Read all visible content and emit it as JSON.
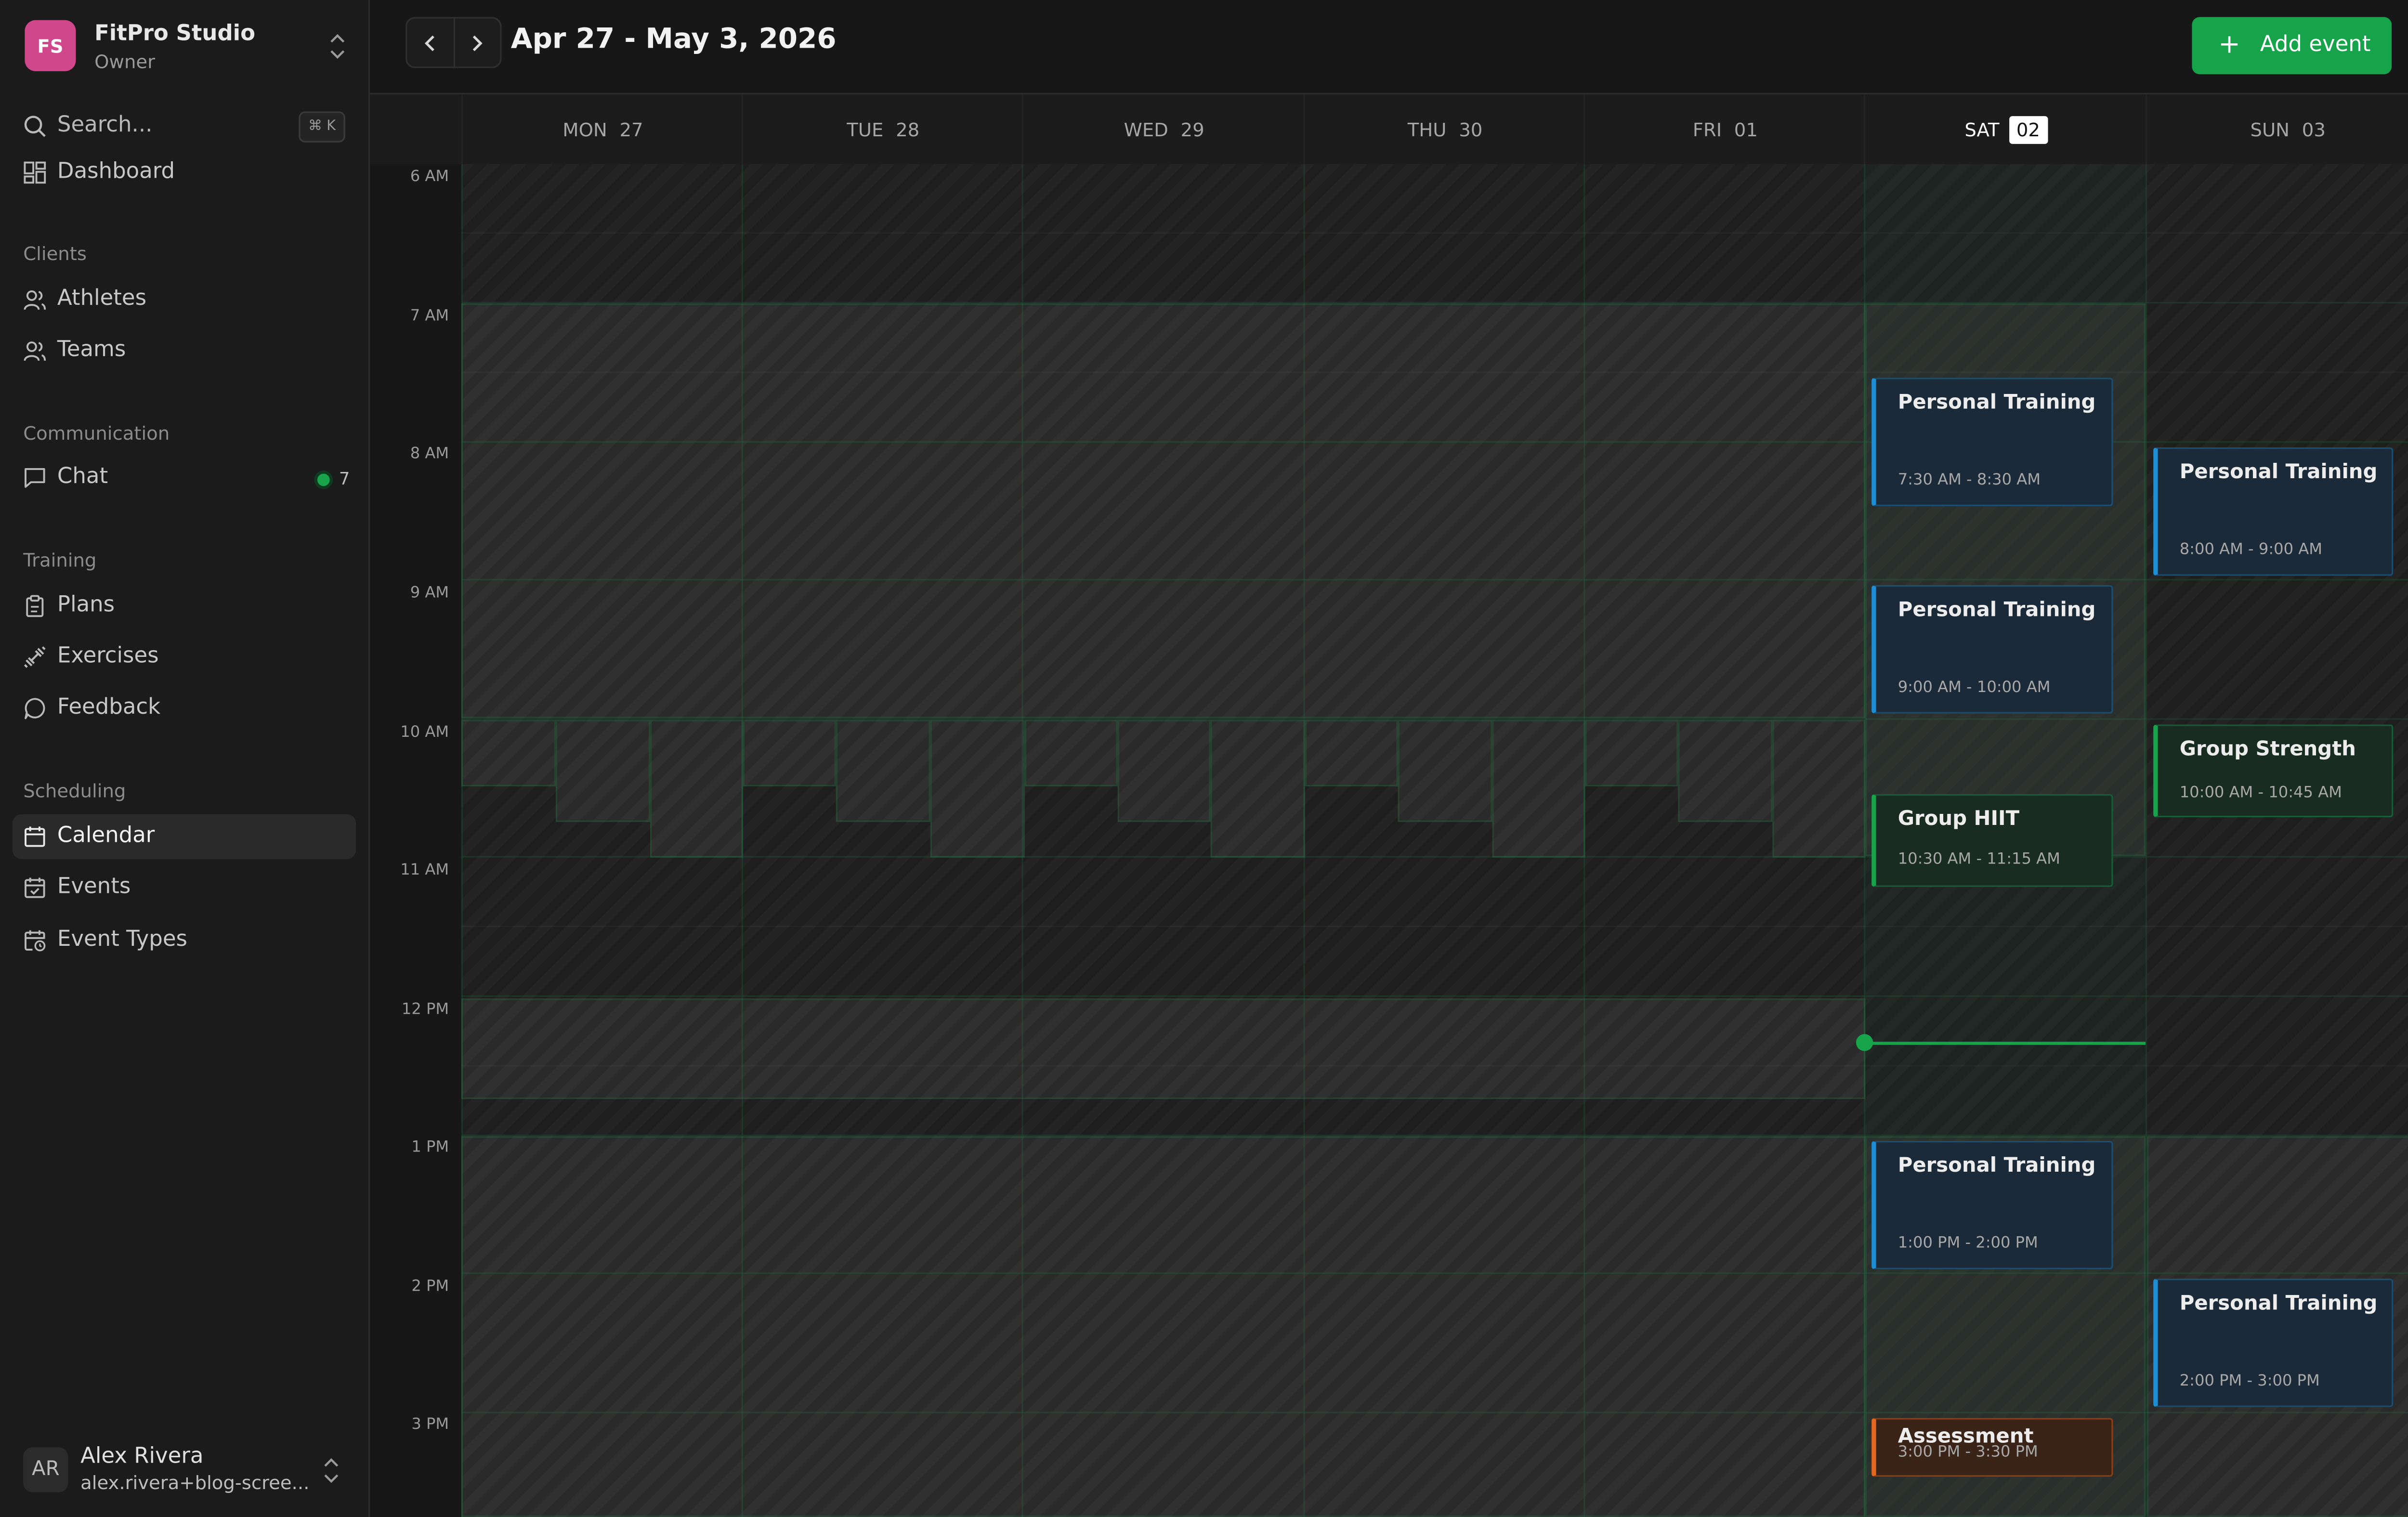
{
  "org": {
    "initials": "FS",
    "name": "FitPro Studio",
    "role": "Owner"
  },
  "search": {
    "label": "Search...",
    "shortcut": "⌘ K"
  },
  "nav": {
    "dashboard": "Dashboard",
    "sections": {
      "clients": "Clients",
      "communication": "Communication",
      "training": "Training",
      "scheduling": "Scheduling"
    },
    "athletes": "Athletes",
    "teams": "Teams",
    "chat": "Chat",
    "chat_badge": "7",
    "plans": "Plans",
    "exercises": "Exercises",
    "feedback": "Feedback",
    "calendar": "Calendar",
    "events": "Events",
    "event_types": "Event Types"
  },
  "user": {
    "initials": "AR",
    "name": "Alex Rivera",
    "email": "alex.rivera+blog-scree..."
  },
  "header": {
    "range": "Apr 27 - May 3, 2026",
    "add_event": "Add event"
  },
  "days": [
    {
      "dow": "MON",
      "num": "27"
    },
    {
      "dow": "TUE",
      "num": "28"
    },
    {
      "dow": "WED",
      "num": "29"
    },
    {
      "dow": "THU",
      "num": "30"
    },
    {
      "dow": "FRI",
      "num": "01"
    },
    {
      "dow": "SAT",
      "num": "02",
      "today": true
    },
    {
      "dow": "SUN",
      "num": "03"
    }
  ],
  "time_labels": [
    "6 AM",
    "7 AM",
    "8 AM",
    "9 AM",
    "10 AM",
    "11 AM",
    "12 PM",
    "1 PM",
    "2 PM",
    "3 PM"
  ],
  "events": [
    {
      "title": "Personal Training",
      "time": "7:30 AM - 8:30 AM",
      "kind": "personal"
    },
    {
      "title": "Personal Training",
      "time": "8:00 AM - 9:00 AM",
      "kind": "personal"
    },
    {
      "title": "Personal Training",
      "time": "9:00 AM - 10:00 AM",
      "kind": "personal"
    },
    {
      "title": "Group Strength",
      "time": "10:00 AM - 10:45 AM",
      "kind": "group"
    },
    {
      "title": "Group HIIT",
      "time": "10:30 AM - 11:15 AM",
      "kind": "group"
    },
    {
      "title": "Personal Training",
      "time": "1:00 PM - 2:00 PM",
      "kind": "personal"
    },
    {
      "title": "Personal Training",
      "time": "2:00 PM - 3:00 PM",
      "kind": "personal"
    },
    {
      "title": "Assessment",
      "time": "3:00 PM - 3:30 PM",
      "kind": "assessment"
    }
  ],
  "colors": {
    "accent": "#16a34a",
    "personal": "#1d8ed6",
    "group": "#17a34a",
    "assessment": "#e4661f",
    "org_avatar": "#d0478c"
  }
}
